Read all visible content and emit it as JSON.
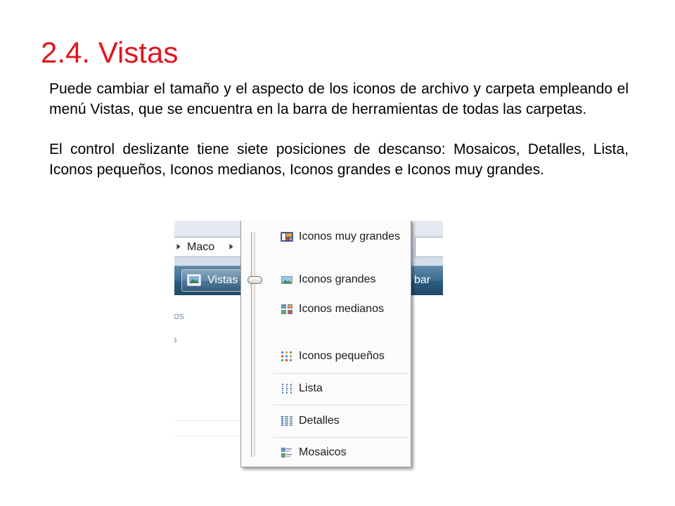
{
  "colors": {
    "title": "#e3141c",
    "toolbar": "#2c6189"
  },
  "slide": {
    "title": "2.4. Vistas",
    "paragraphs": [
      "Puede cambiar el tamaño y el aspecto de los iconos de archivo y carpeta empleando el menú Vistas, que se encuentra en la barra de herramientas de todas las carpetas.",
      "El control deslizante tiene siete posiciones de descanso: Mosaicos, Detalles, Lista, Iconos pequeños, Iconos medianos, Iconos grandes e Iconos muy grandes."
    ]
  },
  "screenshot": {
    "breadcrumb": {
      "items": [
        "Maco"
      ],
      "separator_icon": "chevron-right-icon"
    },
    "toolbar": {
      "views_button": {
        "label": "Vistas",
        "icon": "views-icon"
      },
      "partial_button_label": "bar"
    },
    "navigation_pane": {
      "fragments": [
        "os",
        "s"
      ]
    },
    "views_menu": {
      "items": [
        {
          "label": "Iconos muy grandes",
          "icon": "extra-large-icons-icon"
        },
        {
          "label": "Iconos grandes",
          "icon": "large-icons-icon"
        },
        {
          "label": "Iconos medianos",
          "icon": "medium-icons-icon"
        },
        {
          "label": "Iconos pequeños",
          "icon": "small-icons-icon"
        },
        {
          "label": "Lista",
          "icon": "list-view-icon"
        },
        {
          "label": "Detalles",
          "icon": "details-view-icon"
        },
        {
          "label": "Mosaicos",
          "icon": "tiles-view-icon"
        }
      ],
      "slider": {
        "selected_item_index": 1
      }
    }
  }
}
